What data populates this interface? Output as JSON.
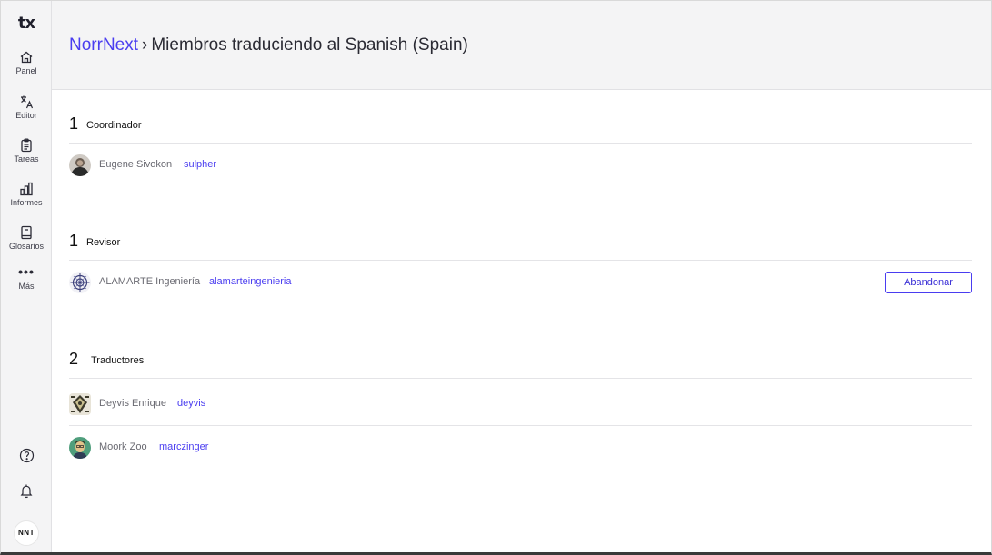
{
  "app": {
    "logo_text": "tx"
  },
  "sidebar": {
    "items": [
      {
        "label": "Panel",
        "icon": "home-icon"
      },
      {
        "label": "Editor",
        "icon": "translate-icon"
      },
      {
        "label": "Tareas",
        "icon": "clipboard-icon"
      },
      {
        "label": "Informes",
        "icon": "bar-chart-icon"
      },
      {
        "label": "Glosarios",
        "icon": "book-icon"
      },
      {
        "label": "Más",
        "icon": "more-dots-icon"
      }
    ],
    "bottom": {
      "help_icon": "help-icon",
      "notifications_icon": "bell-icon",
      "user_initials": "NNT"
    }
  },
  "header": {
    "project_link": "NorrNext",
    "separator": "›",
    "page_title": "Miembros traduciendo al Spanish (Spain)"
  },
  "sections": [
    {
      "count": "1",
      "role": "Coordinador",
      "members": [
        {
          "name": "Eugene Sivokon",
          "username": "sulpher"
        }
      ]
    },
    {
      "count": "1",
      "role": "Revisor",
      "members": [
        {
          "name": "ALAMARTE Ingeniería",
          "username": "alamarteingenieria",
          "action": "Abandonar"
        }
      ]
    },
    {
      "count": "2",
      "role": "Traductores",
      "members": [
        {
          "name": "Deyvis Enrique",
          "username": "deyvis"
        },
        {
          "name": "Moork Zoo",
          "username": "marczinger"
        }
      ]
    }
  ],
  "colors": {
    "accent": "#4a3df0",
    "sidebar_bg": "#f4f4f5",
    "divider": "#e4e4e7"
  }
}
